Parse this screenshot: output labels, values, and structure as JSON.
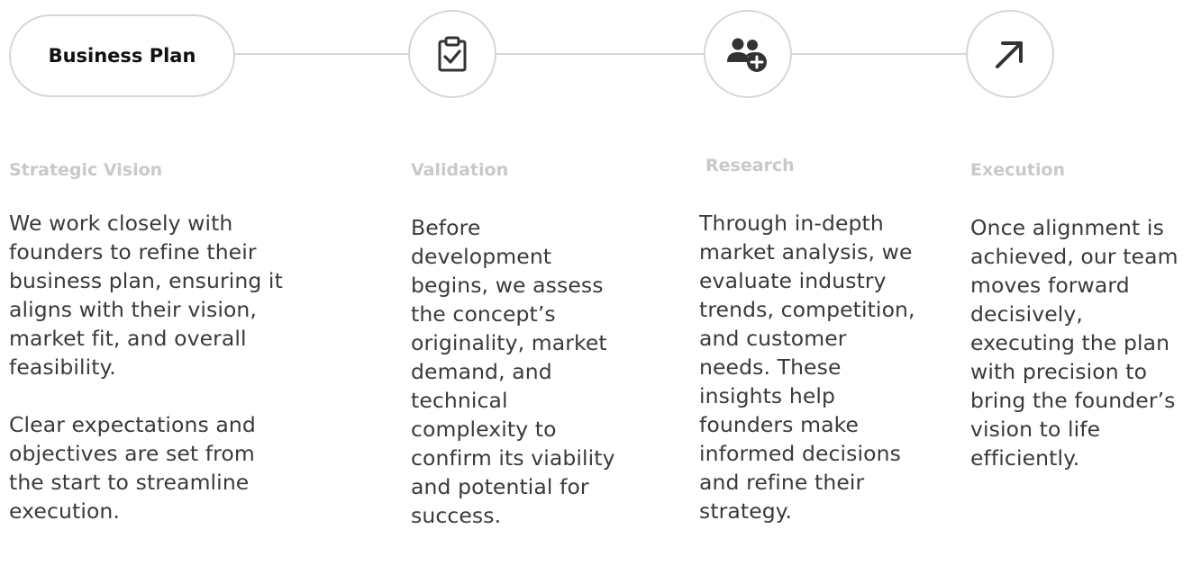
{
  "steps": [
    {
      "button_label": "Business Plan",
      "heading": "Strategic Vision",
      "paragraphs": [
        "We work closely with founders to refine their business plan, ensuring it aligns with their vision, market fit, and overall feasibility.",
        "Clear expectations and objectives are set from the start to streamline execution."
      ]
    },
    {
      "icon": "clipboard-check-icon",
      "heading": "Validation",
      "paragraphs": [
        "Before development begins, we assess the concept’s originality, market demand, and technical complexity to confirm its viability and potential for success."
      ]
    },
    {
      "icon": "user-plus-icon",
      "heading": "Research",
      "paragraphs": [
        "Through in-depth market analysis, we evaluate industry trends, competition, and customer needs. These insights help founders make informed decisions and refine their strategy."
      ]
    },
    {
      "icon": "arrow-up-right-icon",
      "heading": "Execution",
      "paragraphs": [
        "Once alignment is achieved, our team moves forward decisively, executing the plan with precision to bring the founder’s vision to life efficiently."
      ]
    }
  ],
  "colors": {
    "border": "#d6d6d6",
    "heading": "#c9c9c9",
    "body_text": "#3a3a3a",
    "icon": "#333333"
  }
}
